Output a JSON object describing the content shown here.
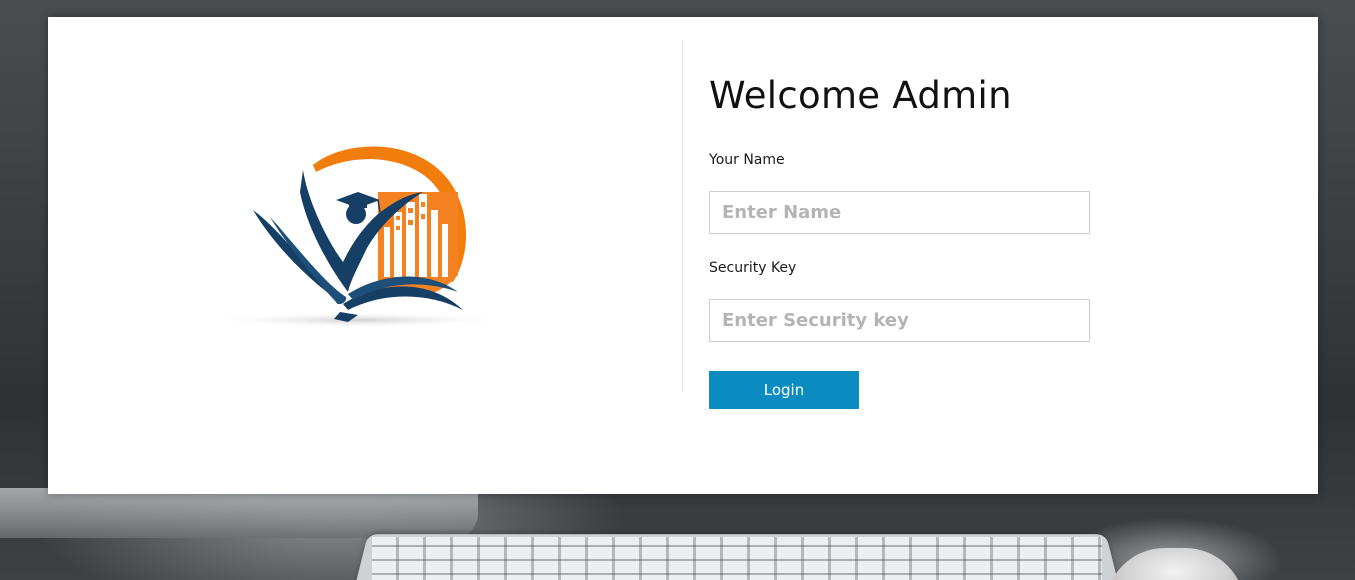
{
  "page": {
    "title": "Welcome Admin"
  },
  "form": {
    "name_label": "Your Name",
    "name_placeholder": "Enter Name",
    "name_value": "",
    "key_label": "Security Key",
    "key_placeholder": "Enter Security key",
    "key_value": "",
    "login_label": "Login"
  },
  "colors": {
    "accent": "#0a8cc0",
    "logo_orange": "#f07d0c",
    "logo_navy": "#163f66"
  },
  "icons": {
    "logo": "education-logo-icon"
  }
}
